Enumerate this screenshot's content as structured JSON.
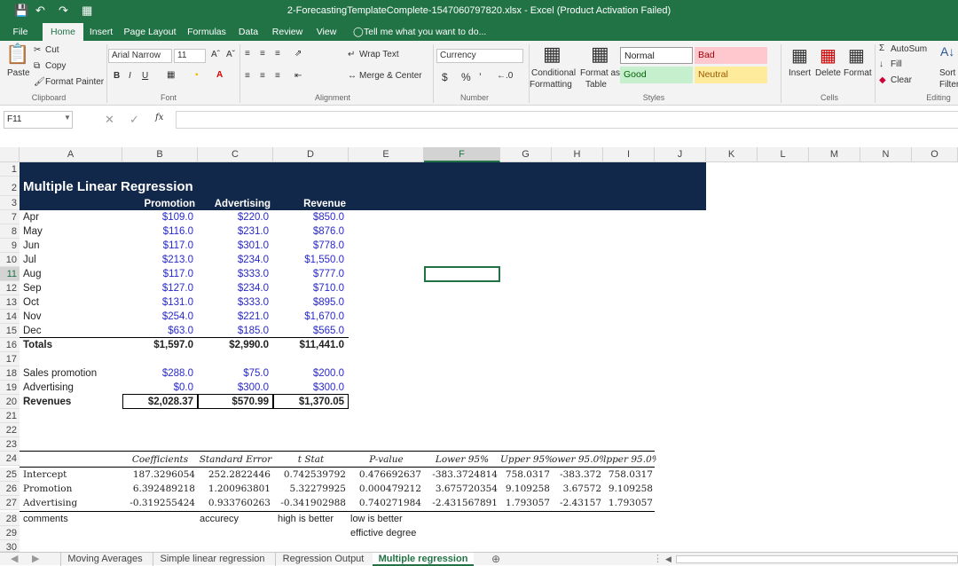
{
  "title_bar": {
    "title": "2-ForecastingTemplateComplete-1547060797820.xlsx - Excel (Product Activation Failed)"
  },
  "menu_tabs": [
    "File",
    "Home",
    "Insert",
    "Page Layout",
    "Formulas",
    "Data",
    "Review",
    "View"
  ],
  "tell_me": "Tell me what you want to do...",
  "ribbon": {
    "clipboard": {
      "paste": "Paste",
      "cut": "Cut",
      "copy": "Copy",
      "format_painter": "Format Painter",
      "group": "Clipboard"
    },
    "font": {
      "name": "Arial Narrow",
      "size": "11",
      "group": "Font"
    },
    "alignment": {
      "wrap": "Wrap Text",
      "merge": "Merge & Center",
      "group": "Alignment"
    },
    "number": {
      "format": "Currency",
      "group": "Number",
      "dollar": "$",
      "pct": "%",
      "comma": "’"
    },
    "styles": {
      "conditional": "Conditional",
      "formatting": "Formatting",
      "format_as": "Format as",
      "table": "Table",
      "normal": "Normal",
      "bad": "Bad",
      "good": "Good",
      "neutral": "Neutral",
      "group": "Styles"
    },
    "cells": {
      "insert": "Insert",
      "delete": "Delete",
      "format": "Format",
      "group": "Cells"
    },
    "editing": {
      "autosum": "AutoSum",
      "fill": "Fill",
      "clear": "Clear",
      "sort": "Sort",
      "filter": "Filter",
      "group": "Editing"
    }
  },
  "formula_bar": {
    "name_box": "F11",
    "fx": "fx"
  },
  "columns": [
    "A",
    "B",
    "C",
    "D",
    "E",
    "F",
    "G",
    "H",
    "I",
    "J",
    "K",
    "L",
    "M",
    "N",
    "O"
  ],
  "rows": [
    "1",
    "2",
    "3",
    "7",
    "8",
    "9",
    "10",
    "11",
    "12",
    "13",
    "14",
    "15",
    "16",
    "17",
    "18",
    "19",
    "20",
    "21",
    "22",
    "23",
    "24",
    "25",
    "26",
    "27",
    "28",
    "29",
    "30"
  ],
  "sheet": {
    "heading": "Multiple Linear Regression",
    "col_headers": [
      "Promotion",
      "Advertising",
      "Revenue"
    ],
    "months": [
      {
        "m": "Apr",
        "p": "$109.0",
        "a": "$220.0",
        "r": "$850.0"
      },
      {
        "m": "May",
        "p": "$116.0",
        "a": "$231.0",
        "r": "$876.0"
      },
      {
        "m": "Jun",
        "p": "$117.0",
        "a": "$301.0",
        "r": "$778.0"
      },
      {
        "m": "Jul",
        "p": "$213.0",
        "a": "$234.0",
        "r": "$1,550.0"
      },
      {
        "m": "Aug",
        "p": "$117.0",
        "a": "$333.0",
        "r": "$777.0"
      },
      {
        "m": "Sep",
        "p": "$127.0",
        "a": "$234.0",
        "r": "$710.0"
      },
      {
        "m": "Oct",
        "p": "$131.0",
        "a": "$333.0",
        "r": "$895.0"
      },
      {
        "m": "Nov",
        "p": "$254.0",
        "a": "$221.0",
        "r": "$1,670.0"
      },
      {
        "m": "Dec",
        "p": "$63.0",
        "a": "$185.0",
        "r": "$565.0"
      }
    ],
    "totals": {
      "label": "Totals",
      "p": "$1,597.0",
      "a": "$2,990.0",
      "r": "$11,441.0"
    },
    "sales_promotion": {
      "label": "Sales promotion",
      "b": "$288.0",
      "c": "$75.0",
      "d": "$200.0"
    },
    "advertising": {
      "label": "Advertising",
      "b": "$0.0",
      "c": "$300.0",
      "d": "$300.0"
    },
    "revenues": {
      "label": "Revenues",
      "b": "$2,028.37",
      "c": "$570.99",
      "d": "$1,370.05"
    },
    "reg_headers": [
      "Coefficients",
      "Standard Error",
      "t Stat",
      "P-value",
      "Lower 95%",
      "Upper 95%",
      "ower 95.0%",
      "lpper 95.0%"
    ],
    "reg_rows": [
      {
        "label": "Intercept",
        "v": [
          "187.3296054",
          "252.2822446",
          "0.742539792",
          "0.476692637",
          "-383.3724814",
          "758.0317",
          "-383.372",
          "758.0317"
        ]
      },
      {
        "label": "Promotion",
        "v": [
          "6.392489218",
          "1.200963801",
          "5.32279925",
          "0.000479212",
          "3.675720354",
          "9.109258",
          "3.67572",
          "9.109258"
        ]
      },
      {
        "label": "Advertising",
        "v": [
          "-0.319255424",
          "0.933760263",
          "-0.341902988",
          "0.740271984",
          "-2.431567891",
          "1.793057",
          "-2.43157",
          "1.793057"
        ]
      }
    ],
    "comments": {
      "label": "comments",
      "b": "accurecy",
      "c": "high is  better",
      "d1": "low is better",
      "d2": "effictive degree"
    }
  },
  "sheet_tabs": [
    "Moving Averages",
    "Simple linear regression",
    "Regression Output",
    "Multiple regression"
  ]
}
